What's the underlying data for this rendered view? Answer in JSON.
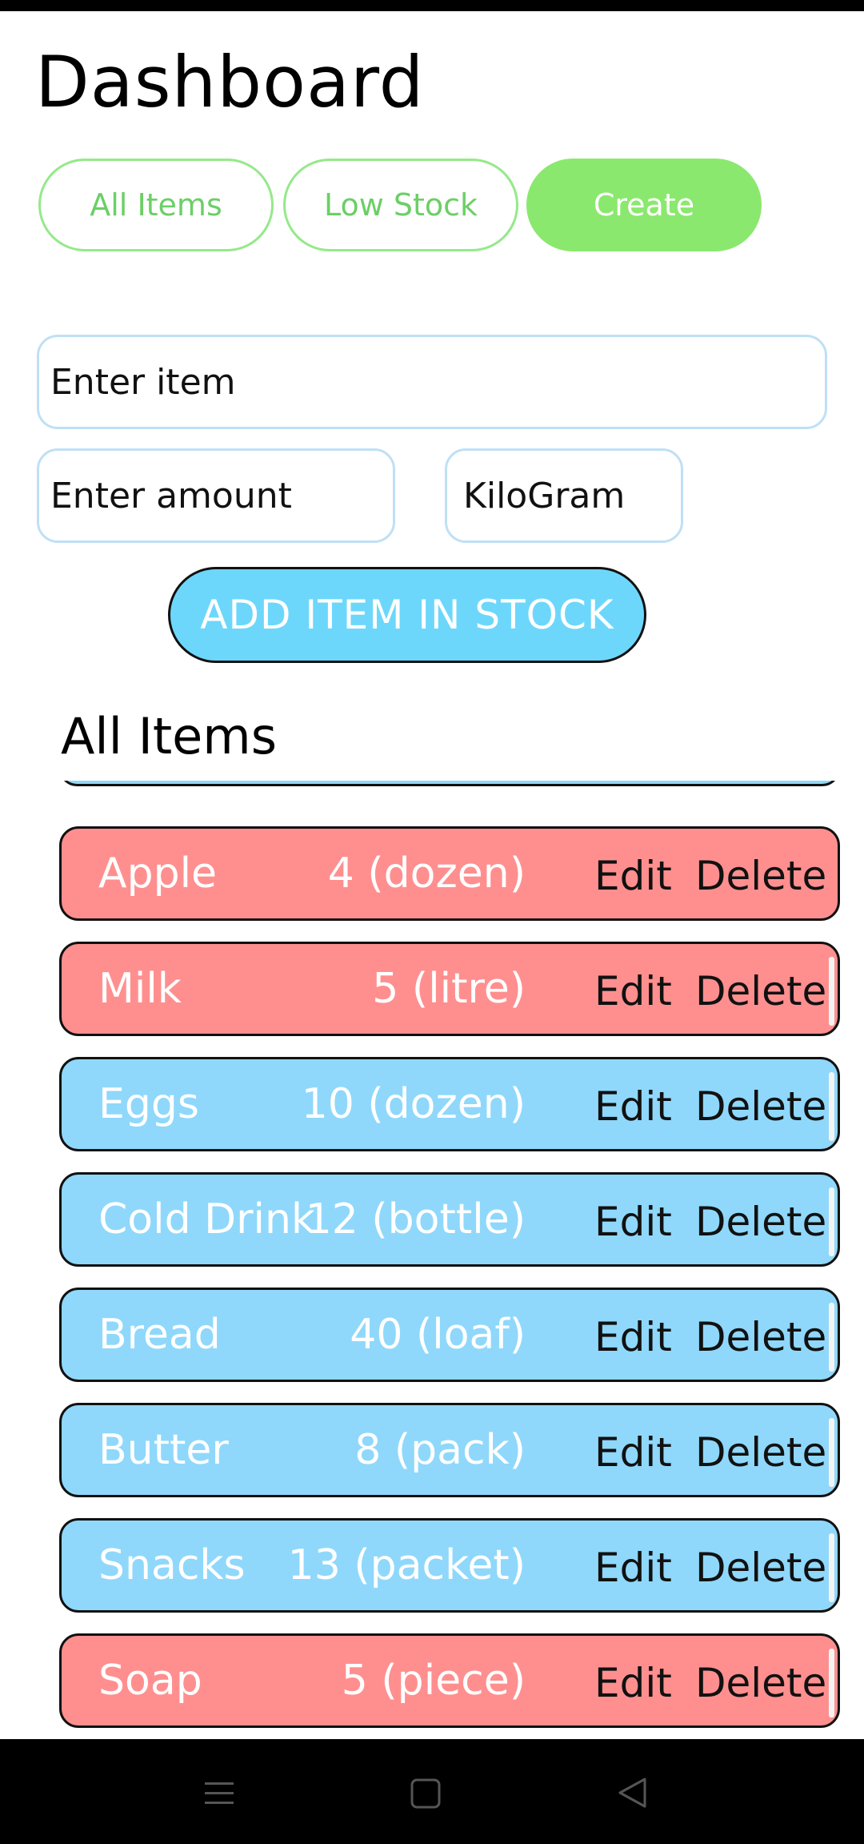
{
  "header": {
    "title": "Dashboard"
  },
  "tabs": [
    {
      "label": "All Items",
      "active": false
    },
    {
      "label": "Low Stock",
      "active": false
    },
    {
      "label": "Create",
      "active": true
    }
  ],
  "form": {
    "item_placeholder": "Enter item",
    "amount_placeholder": "Enter amount",
    "unit_value": "KiloGram",
    "submit_label": "ADD ITEM IN STOCK"
  },
  "list": {
    "title": "All Items",
    "edit_label": "Edit",
    "delete_label": "Delete",
    "items": [
      {
        "name": "Apple",
        "qty": "4 (dozen)",
        "status": "low"
      },
      {
        "name": "Milk",
        "qty": "5 (litre)",
        "status": "low"
      },
      {
        "name": "Eggs",
        "qty": "10 (dozen)",
        "status": "ok"
      },
      {
        "name": "Cold Drink",
        "qty": "12 (bottle)",
        "status": "ok"
      },
      {
        "name": "Bread",
        "qty": "40 (loaf)",
        "status": "ok"
      },
      {
        "name": "Butter",
        "qty": "8 (pack)",
        "status": "ok"
      },
      {
        "name": "Snacks",
        "qty": "13 (packet)",
        "status": "ok"
      },
      {
        "name": "Soap",
        "qty": "5 (piece)",
        "status": "low"
      }
    ]
  },
  "colors": {
    "low_stock": "#ff8f8f",
    "in_stock": "#8fd8fb",
    "accent_green": "#8be86e",
    "button_blue": "#6dd7fb"
  },
  "navbar": {
    "icons": [
      "menu-icon",
      "home-square-icon",
      "back-triangle-icon"
    ]
  }
}
